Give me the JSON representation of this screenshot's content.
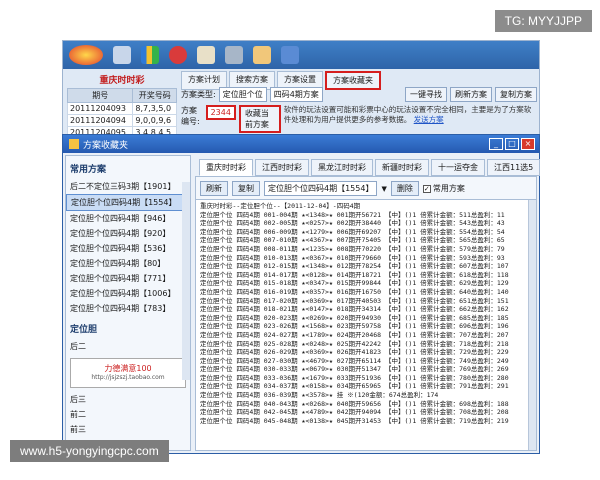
{
  "watermark_top": "TG: MYYJJPP",
  "watermark_bottom": "www.h5-yongyingcpc.com",
  "bg": {
    "left_title": "重庆时时彩",
    "table_headers": [
      "期号",
      "开奖号码"
    ],
    "table_rows": [
      [
        "20111204093",
        "8,7,3,5,0"
      ],
      [
        "20111204094",
        "9,0,0,9,6"
      ],
      [
        "20111204095",
        "3,4,8,4,5"
      ]
    ],
    "tabs": [
      "方案计划",
      "搜索方案",
      "方案设置",
      "方案收藏夹"
    ],
    "type_label": "方案类型:",
    "type_value": "定位胆个位",
    "scheme_value": "四码4期方案",
    "one_key_button": "一键寻找",
    "refresh_button": "刷新方案",
    "copy_button": "复制方案",
    "num_label": "方案编号:",
    "num_value": "2344",
    "collect_button": "收藏当前方案",
    "note": "软件的玩法设置可能和彩票中心的玩法设置不完全相同，主要是为了方案软件处理和为用户提供更多的参考数据。",
    "note_link": "发送方案"
  },
  "dialog": {
    "title": "方案收藏夹",
    "left": {
      "section1": "常用方案",
      "items": [
        "后二不定位三码3期【1901】",
        "定位胆个位四码4期【1554】",
        "定位胆个位四码4期【946】",
        "定位胆个位四码4期【920】",
        "定位胆个位四码4期【536】",
        "定位胆个位四码4期【80】",
        "定位胆个位四码4期【771】",
        "定位胆个位四码4期【1006】",
        "定位胆个位四码4期【783】"
      ],
      "section2": "定位胆",
      "sub_items": [
        "后二",
        "后三",
        "前二",
        "前三"
      ],
      "ad_text": "力德满意100",
      "ad_url": "http://jsjzszj.taobao.com"
    },
    "tabs": [
      "重庆时时彩",
      "江西时时彩",
      "黑龙江时时彩",
      "新疆时时彩",
      "十一运夺金",
      "江西11选5"
    ],
    "tool": {
      "refresh": "刷新",
      "copy": "复制",
      "select": "定位胆个位四码4期【1554】",
      "delete": "删除",
      "check_label": "常用方案"
    },
    "content_header": "重庆时时彩--定位胆个位--【2011-12-04】-四码4期",
    "content_lines": [
      "定位胆个位 四码4期 001-004期 ★<1348>★ 001期开56721 【中】()1 倍累计金额：511总盈利：11",
      "定位胆个位 四码4期 002-005期 ★<0257>★ 002期开38440 【中】()1 倍累计金额：543总盈利：43",
      "定位胆个位 四码4期 006-009期 ★<1279>★ 006期开69207 【中】()1 倍累计金额：554总盈利：54",
      "定位胆个位 四码4期 007-010期 ★<4367>★ 007期开75405 【中】()1 倍累计金额：565总盈利：65",
      "定位胆个位 四码4期 008-011期 ★<1235>★ 008期开70220 【中】()1 倍累计金额：579总盈利：79",
      "定位胆个位 四码4期 010-013期 ★<0367>★ 010期开79660 【中】()1 倍累计金额：593总盈利：93",
      "定位胆个位 四码4期 012-015期 ★<1348>★ 012期开78254 【中】()1 倍累计金额：607总盈利：107",
      "定位胆个位 四码4期 014-017期 ★<0128>★ 014期开18721 【中】()1 倍累计金额：618总盈利：118",
      "定位胆个位 四码4期 015-018期 ★<0347>★ 015期开99844 【中】()1 倍累计金额：629总盈利：129",
      "定位胆个位 四码4期 016-019期 ★<0357>★ 016期开16750 【中】()1 倍累计金额：640总盈利：140",
      "定位胆个位 四码4期 017-020期 ★<0369>★ 017期开40503 【中】()1 倍累计金额：651总盈利：151",
      "定位胆个位 四码4期 018-021期 ★<0147>★ 018期开34314 【中】()1 倍累计金额：662总盈利：162",
      "定位胆个位 四码4期 020-023期 ★<0269>★ 020期开94930 【中】()1 倍累计金额：685总盈利：185",
      "定位胆个位 四码4期 023-026期 ★<1568>★ 023期开59758 【中】()1 倍累计金额：696总盈利：196",
      "定位胆个位 四码4期 024-027期 ★<1789>★ 024期开20468 【中】()1 倍累计金额：707总盈利：207",
      "定位胆个位 四码4期 025-028期 ★<0248>★ 025期开42242 【中】()1 倍累计金额：718总盈利：218",
      "定位胆个位 四码4期 026-029期 ★<0369>★ 026期开41823 【中】()1 倍累计金额：729总盈利：229",
      "定位胆个位 四码4期 027-030期 ★<4679>★ 027期开65114 【中】()1 倍累计金额：749总盈利：249",
      "定位胆个位 四码4期 030-033期 ★<0679>★ 030期开51347 【中】()1 倍累计金额：769总盈利：269",
      "定位胆个位 四码4期 033-036期 ★<1679>★ 033期开51936 【中】()1 倍累计金额：780总盈利：280",
      "定位胆个位 四码4期 034-037期 ★<0158>★ 034期开65965 【中】()1 倍累计金额：791总盈利：291",
      "定位胆个位 四码4期 036-039期 ★<3578>★ 挂 ※(120金额：674总盈利：174",
      "定位胆个位 四码4期 040-043期 ★<0268>★ 040期开59656 【中】()1 倍累计金额：698总盈利：188",
      "定位胆个位 四码4期 042-045期 ★<4789>★ 042期开94094 【中】()1 倍累计金额：708总盈利：208",
      "定位胆个位 四码4期 045-048期 ★<0138>★ 045期开31453 【中】()1 倍累计金额：719总盈利：219"
    ]
  }
}
